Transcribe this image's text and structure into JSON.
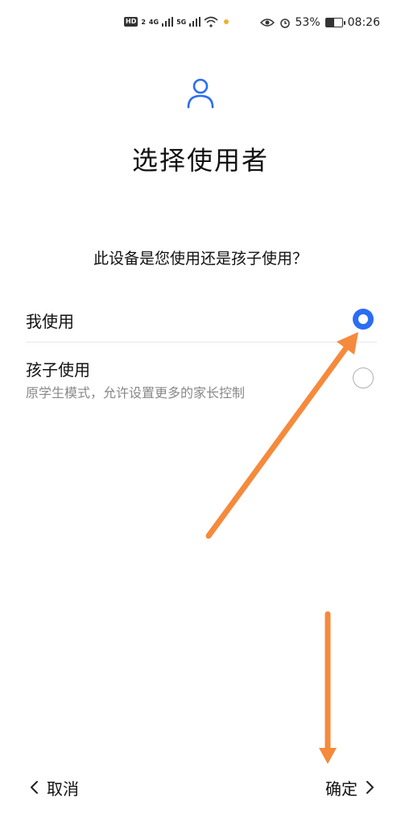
{
  "status_bar": {
    "hd": "HD",
    "hd_sub": "2",
    "net1": "4G",
    "net2": "5G",
    "battery_percent": "53%",
    "battery_level": 0.53,
    "time": "08:26"
  },
  "page": {
    "title": "选择使用者",
    "question": "此设备是您使用还是孩子使用？"
  },
  "options": [
    {
      "label": "我使用",
      "subtitle": "",
      "selected": true
    },
    {
      "label": "孩子使用",
      "subtitle": "原学生模式，允许设置更多的家长控制",
      "selected": false
    }
  ],
  "footer": {
    "cancel_label": "取消",
    "confirm_label": "确定"
  },
  "colors": {
    "accent": "#2a6df4",
    "annotation_arrow": "#f58a3c"
  },
  "icons": {
    "user": "user-icon",
    "back": "chevron-left-icon",
    "forward": "chevron-right-icon"
  }
}
